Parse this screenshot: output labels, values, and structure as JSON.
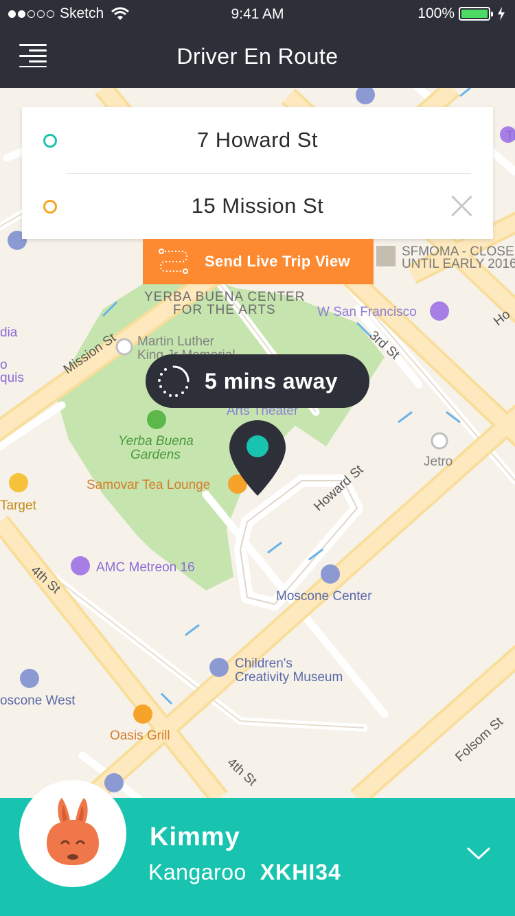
{
  "status_bar": {
    "carrier": "Sketch",
    "time": "9:41 AM",
    "battery": "100%",
    "battery_level": 1.0,
    "signal_bars": 2
  },
  "nav": {
    "title": "Driver En Route",
    "menu_icon": "hamburger-menu-icon"
  },
  "route": {
    "pickup": "7 Howard St",
    "dropoff": "15 Mission St",
    "pickup_color": "#18c4b0",
    "dropoff_color": "#f5a623"
  },
  "share": {
    "label": "Send Live Trip View",
    "color": "#fd8a31"
  },
  "eta": {
    "label": "5 mins away"
  },
  "map": {
    "streets": [
      "Mission St",
      "3rd St",
      "Howard St",
      "4th St",
      "4th St",
      "Folsom St",
      "Ho"
    ],
    "pois": {
      "ybca": [
        "YERBA BUENA CENTER",
        "FOR THE ARTS"
      ],
      "sfmoma": [
        "SFMOMA - CLOSE",
        "UNTIL EARLY 2016"
      ],
      "w_sf": "W San Francisco",
      "mlk": [
        "Martin Luther",
        "King Jr Memorial"
      ],
      "arts_theater": "Arts Theater",
      "ybg": [
        "Yerba Buena",
        "Gardens"
      ],
      "samovar": "Samovar Tea Lounge",
      "jetro": "Jetro",
      "target": "Target",
      "amc": "AMC Metreon 16",
      "moscone": "Moscone Center",
      "childrens": [
        "Children's",
        "Creativity Museum"
      ],
      "moscone_west": "oscone West",
      "oasis": "Oasis Grill",
      "edge_left1": "dia",
      "edge_left2": "o",
      "edge_left3": "quis",
      "edge_right_top": "Tr"
    }
  },
  "driver": {
    "name": "Kimmy",
    "vehicle": "Kangaroo",
    "plate": "XKHI34"
  },
  "colors": {
    "nav_bg": "#2e3039",
    "panel_bg": "#18c4b0",
    "map_bg": "#f6f1e9"
  }
}
